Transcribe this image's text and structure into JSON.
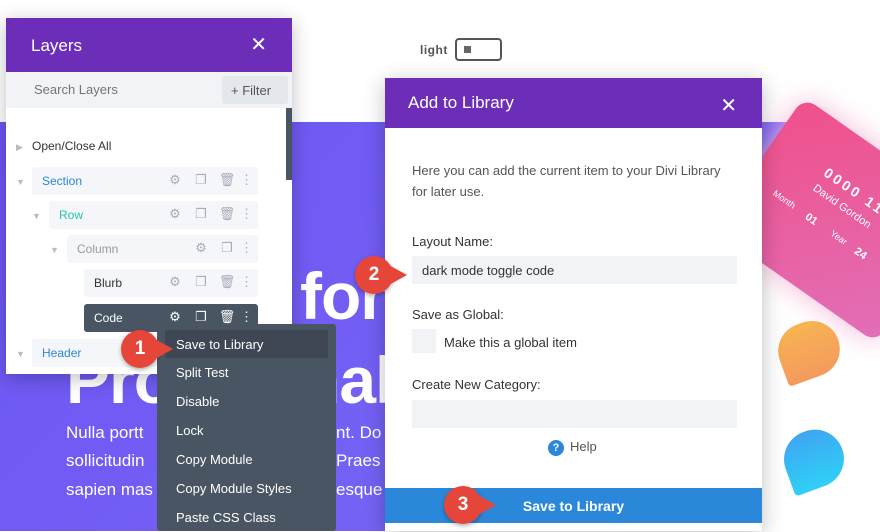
{
  "toggle": {
    "label": "light"
  },
  "hero": {
    "line1": "for",
    "line2a": "Pro",
    "line2b": "nal",
    "para": [
      "Nulla portt",
      "nt. Do",
      "sollicitudin",
      "Praes",
      "sapien mas",
      "esque"
    ]
  },
  "card": {
    "number": "0000 11",
    "name": "David Gordon",
    "month_label": "Month",
    "month": "01",
    "year_label": "Year",
    "year": "24"
  },
  "layers": {
    "title": "Layers",
    "search_placeholder": "Search Layers",
    "filter": "+ Filter",
    "open_close": "Open/Close All",
    "items": [
      {
        "label": "Section",
        "color": "#2b87da"
      },
      {
        "label": "Row",
        "color": "#29c4a9"
      },
      {
        "label": "Column",
        "color": "#999999"
      },
      {
        "label": "Blurb",
        "color": "#333333"
      },
      {
        "label": "Code",
        "color": "#ffffff"
      },
      {
        "label": "Header",
        "color": "#2b87da"
      }
    ]
  },
  "context_menu": {
    "items": [
      "Save to Library",
      "Split Test",
      "Disable",
      "Lock",
      "Copy Module",
      "Copy Module Styles",
      "Paste CSS Class"
    ]
  },
  "modal": {
    "title": "Add to Library",
    "desc1": "Here you can add the current item to your Divi Library",
    "desc2": "for later use.",
    "layout_name_label": "Layout Name:",
    "layout_name_value": "dark mode toggle code",
    "global_label": "Save as Global:",
    "global_checkbox": "Make this a global item",
    "category_label": "Create New Category:",
    "category_value": "",
    "help": "Help",
    "save": "Save to Library"
  },
  "badges": [
    "1",
    "2",
    "3"
  ],
  "colors": {
    "purple_header": "#6c2eb9",
    "save_blue": "#2b87da",
    "badge_red": "#e6463a",
    "menu_bg": "#4a5563"
  }
}
